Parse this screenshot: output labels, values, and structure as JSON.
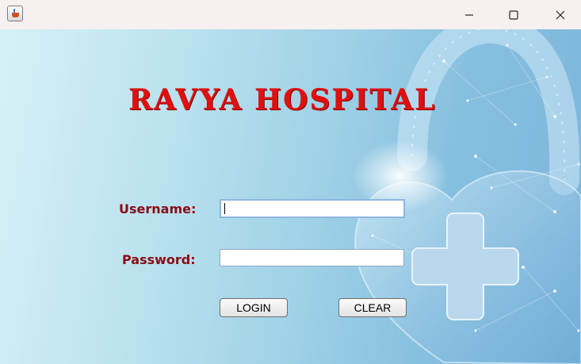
{
  "window": {
    "icon": "java-app-icon",
    "controls": [
      "minimize-icon",
      "maximize-icon",
      "close-icon"
    ]
  },
  "header": {
    "title": "RAVYA HOSPITAL"
  },
  "form": {
    "username_label": "Username:",
    "username_value": "",
    "password_label": "Password:",
    "password_value": "",
    "login_label": "LOGIN",
    "clear_label": "CLEAR"
  },
  "colors": {
    "title": "#e01010",
    "labels": "#8b0a14",
    "background_light": "#d7f1f7",
    "background_dark": "#7db5da"
  }
}
